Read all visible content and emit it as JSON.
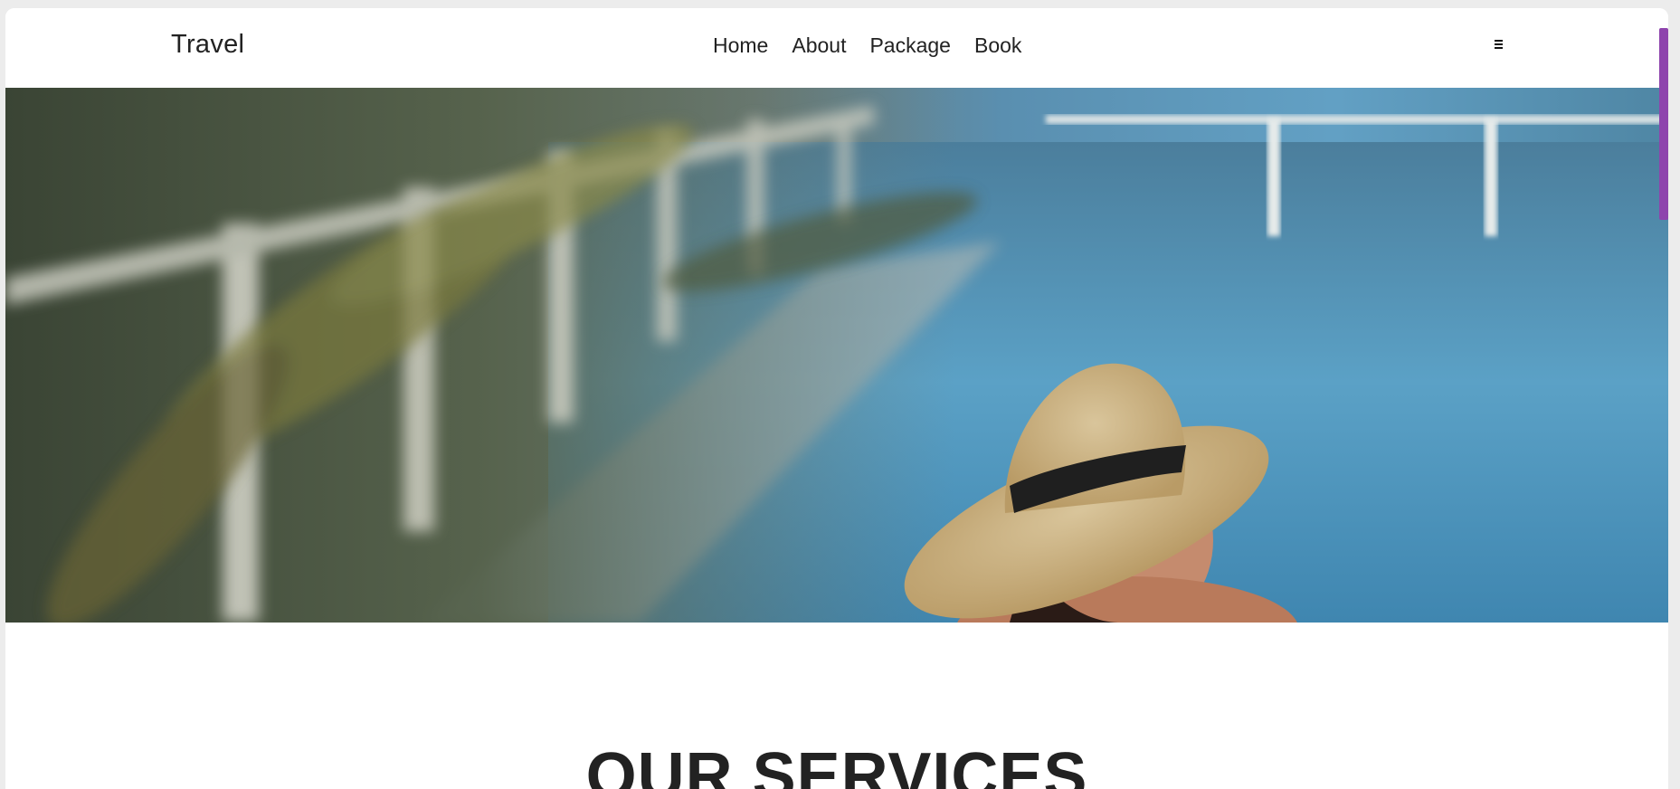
{
  "navbar": {
    "brand": "Travel",
    "links": [
      {
        "label": "Home"
      },
      {
        "label": "About"
      },
      {
        "label": "Package"
      },
      {
        "label": "Book"
      }
    ],
    "menu_icon": "hamburger-icon"
  },
  "hero": {
    "image_subject": "woman in straw hat in swimming pool",
    "prev_icon": "chevron-left-icon",
    "next_icon": "chevron-right-icon"
  },
  "services": {
    "title": "OUR SERVICES"
  },
  "colors": {
    "accent_scrollbar": "#8e44ad",
    "text": "#222222",
    "background": "#ffffff"
  }
}
